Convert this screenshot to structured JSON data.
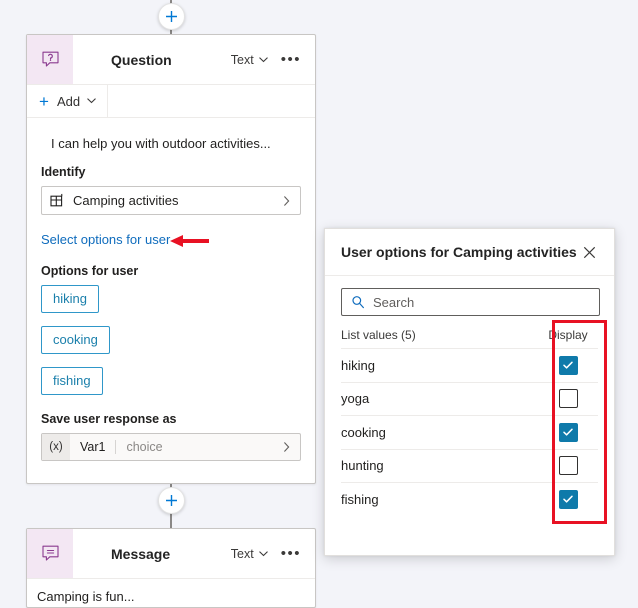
{
  "canvas": {
    "background": "#f3f4f9",
    "add_node_tooltip": "Add node"
  },
  "question_node": {
    "icon": "question-bubble-icon",
    "title": "Question",
    "type_label": "Text",
    "chevron": "chevron-down-icon",
    "ellipsis": "•••",
    "add_bar": {
      "plus": "+",
      "label": "Add",
      "chevron": "chevron-down-icon"
    },
    "prompt": "I can help you with outdoor activities...",
    "identify": {
      "label": "Identify",
      "icon": "entity-icon",
      "value": "Camping activities",
      "arrow": "chevron-right-icon"
    },
    "select_options_link": "Select options for user",
    "options": {
      "label": "Options for user",
      "items": [
        "hiking",
        "cooking",
        "fishing"
      ]
    },
    "save_response": {
      "label": "Save user response as",
      "var_icon": "(x)",
      "var_name": "Var1",
      "var_type": "choice",
      "arrow": "chevron-right-icon"
    }
  },
  "message_node": {
    "icon": "message-bubble-icon",
    "title": "Message",
    "type_label": "Text",
    "chevron": "chevron-down-icon",
    "ellipsis": "•••",
    "text": "Camping is fun..."
  },
  "panel": {
    "title": "User options for Camping activities",
    "close_icon": "close-icon",
    "search": {
      "icon": "search-icon",
      "placeholder": "Search",
      "value": ""
    },
    "list_header": {
      "values_label": "List values (5)",
      "display_label": "Display"
    },
    "rows": [
      {
        "label": "hiking",
        "display": true
      },
      {
        "label": "yoga",
        "display": false
      },
      {
        "label": "cooking",
        "display": true
      },
      {
        "label": "hunting",
        "display": false
      },
      {
        "label": "fishing",
        "display": true
      }
    ]
  },
  "annotations": {
    "highlight_color": "#e81123",
    "arrow_icon": "left-arrow-annotation",
    "rect_icon": "rectangle-annotation"
  },
  "colors": {
    "link": "#0f6cbd",
    "chip_border": "#2f97c9",
    "chip_text": "#1a7fab",
    "checkbox_on": "#0f7aaa",
    "node_icon_bg": "#f3e7f3",
    "node_icon": "#8a3a8f"
  }
}
